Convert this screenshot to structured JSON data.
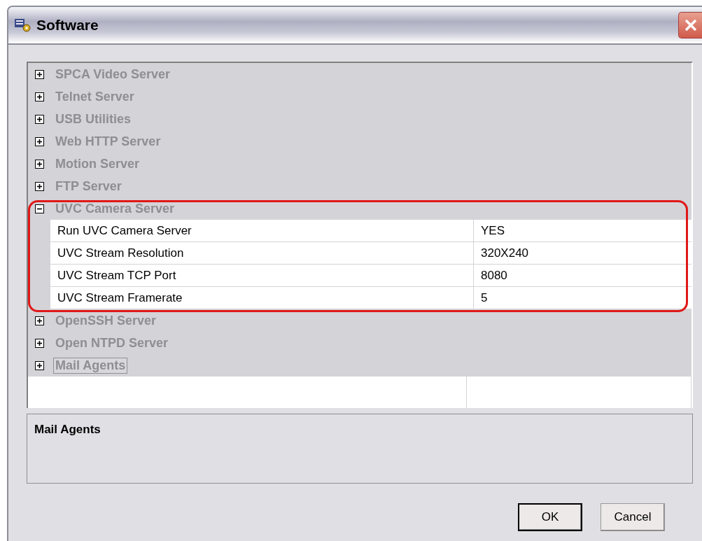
{
  "window": {
    "title": "Software"
  },
  "property_grid": {
    "categories": [
      {
        "name": "SPCA Video Server",
        "expanded": false,
        "selected": false
      },
      {
        "name": "Telnet Server",
        "expanded": false,
        "selected": false
      },
      {
        "name": "USB Utilities",
        "expanded": false,
        "selected": false
      },
      {
        "name": "Web HTTP Server",
        "expanded": false,
        "selected": false
      },
      {
        "name": "Motion Server",
        "expanded": false,
        "selected": false
      },
      {
        "name": "FTP Server",
        "expanded": false,
        "selected": false
      },
      {
        "name": "UVC Camera Server",
        "expanded": true,
        "selected": false,
        "properties": [
          {
            "name": "Run UVC Camera Server",
            "value": "YES"
          },
          {
            "name": "UVC Stream Resolution",
            "value": "320X240"
          },
          {
            "name": "UVC Stream TCP Port",
            "value": "8080"
          },
          {
            "name": "UVC Stream Framerate",
            "value": "5"
          }
        ]
      },
      {
        "name": "OpenSSH Server",
        "expanded": false,
        "selected": false
      },
      {
        "name": "Open NTPD Server",
        "expanded": false,
        "selected": false
      },
      {
        "name": "Mail Agents",
        "expanded": false,
        "selected": true
      }
    ]
  },
  "description": {
    "title": "Mail Agents"
  },
  "buttons": [
    {
      "label": "OK",
      "default": true
    },
    {
      "label": "Cancel",
      "default": false
    }
  ]
}
